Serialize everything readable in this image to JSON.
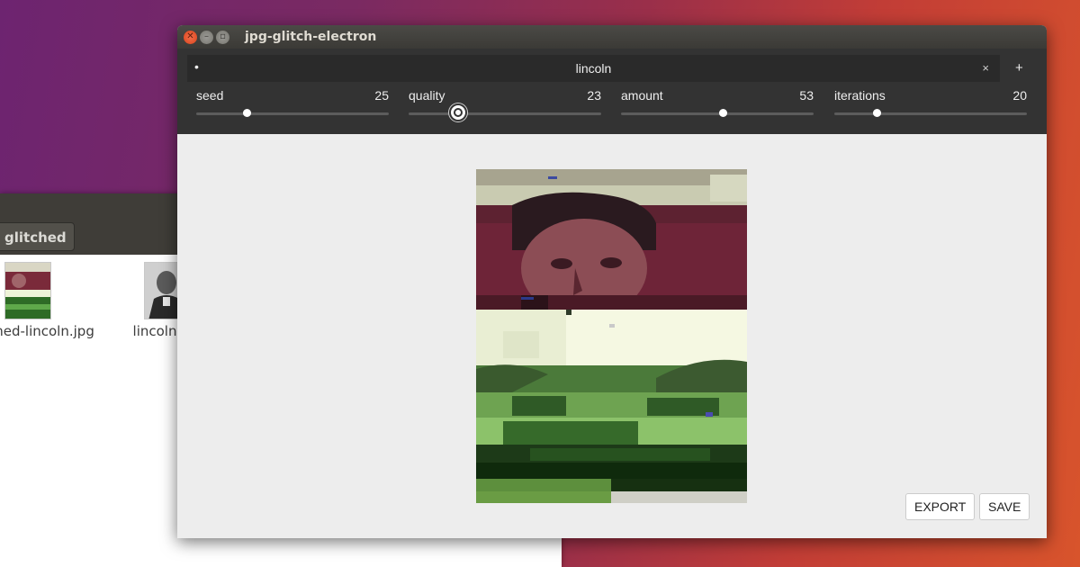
{
  "file_manager": {
    "breadcrumb": "glitched",
    "files": [
      {
        "name": "ched-lincoln.jpg",
        "icon": "glitched-lincoln-thumbnail"
      },
      {
        "name": "lincoln.jpg",
        "icon": "lincoln-thumbnail"
      }
    ]
  },
  "window": {
    "title": "jpg-glitch-electron"
  },
  "tab": {
    "dot": "•",
    "title": "lincoln",
    "close": "×",
    "add": "+"
  },
  "controls": [
    {
      "label": "seed",
      "value": "25",
      "fraction": 0.26
    },
    {
      "label": "quality",
      "value": "23",
      "fraction": 0.25
    },
    {
      "label": "amount",
      "value": "53",
      "fraction": 0.53
    },
    {
      "label": "iterations",
      "value": "20",
      "fraction": 0.22
    }
  ],
  "actions": {
    "export": "EXPORT",
    "save": "SAVE"
  },
  "colors": {
    "accent_close": "#e0502a",
    "toolbar_bg": "#333333",
    "canvas_bg": "#ededed"
  }
}
